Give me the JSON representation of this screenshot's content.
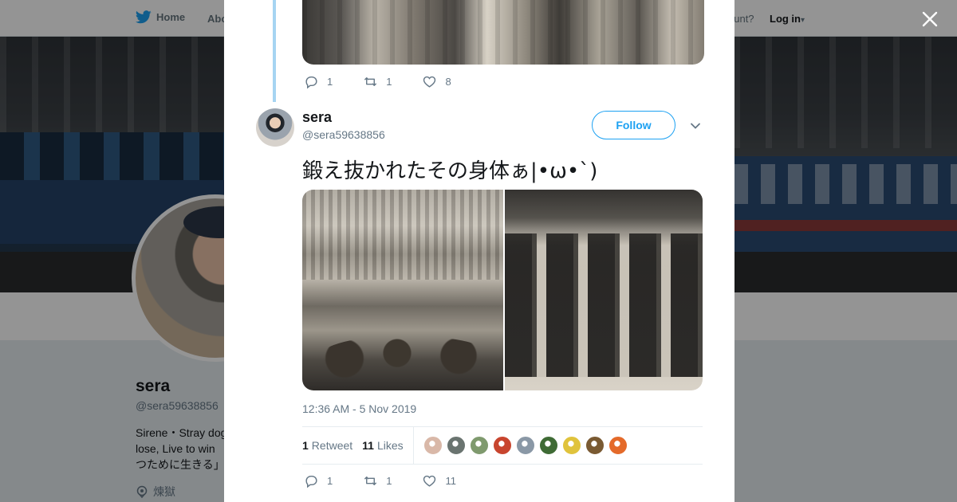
{
  "topbar": {
    "home_label": "Home",
    "about_label": "Abo",
    "account_prompt": "ccount?",
    "login_label": "Log in",
    "login_caret": "▾"
  },
  "profile": {
    "name": "sera",
    "handle": "@sera59638856",
    "bio_line1": "Sirene・Stray dog",
    "bio_line2": "lose, Live to win",
    "bio_line3": "つために生きる」",
    "location": "煉獄"
  },
  "modal": {
    "close_glyph": "✕",
    "previous_tweet": {
      "replies": "1",
      "retweets": "1",
      "likes": "8"
    },
    "tweet": {
      "author_name": "sera",
      "author_handle": "@sera59638856",
      "follow_label": "Follow",
      "text": "鍛え抜かれたその身体ぁ|•ω•`)",
      "timestamp": "12:36 AM - 5 Nov 2019",
      "retweet_count": "1",
      "retweet_label": "Retweet",
      "like_count": "11",
      "like_label": "Likes",
      "likers": [
        {
          "color": "#d9b8a8"
        },
        {
          "color": "#6a7470"
        },
        {
          "color": "#7f9a6e"
        },
        {
          "color": "#c8452e"
        },
        {
          "color": "#8a98a6"
        },
        {
          "color": "#3f6b35"
        },
        {
          "color": "#e0c33c"
        },
        {
          "color": "#7a5a32"
        },
        {
          "color": "#e46a2a"
        }
      ],
      "actions": {
        "replies": "1",
        "retweets": "1",
        "likes": "11"
      }
    }
  },
  "colors": {
    "accent": "#1da1f2",
    "thread_line": "#a6d4f2",
    "muted_text": "#657786"
  },
  "icons": [
    "twitter-bird-icon",
    "close-icon",
    "reply-icon",
    "retweet-icon",
    "heart-icon",
    "chevron-down-icon",
    "location-pin-icon"
  ]
}
